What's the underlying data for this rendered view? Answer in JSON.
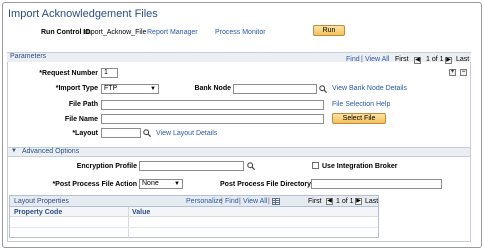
{
  "page": {
    "title": "Import Acknowledgement Files",
    "run_control_label": "Run Control ID",
    "run_control_value": "Import_Acknow_File",
    "report_manager": "Report Manager",
    "process_monitor": "Process Monitor",
    "run_button": "Run"
  },
  "parameters": {
    "header": "Parameters",
    "find": "Find",
    "view_all": "View All",
    "first": "First",
    "pager": "1 of 1",
    "last": "Last",
    "request_number_label": "*Request Number",
    "request_number_value": "1",
    "import_type_label": "*Import Type",
    "import_type_value": "FTP",
    "bank_node_label": "Bank Node",
    "bank_node_value": "",
    "view_bank_node_details": "View Bank Node Details",
    "file_path_label": "File Path",
    "file_path_value": "",
    "file_selection_help": "File Selection Help",
    "file_name_label": "File Name",
    "file_name_value": "",
    "select_file_button": "Select File",
    "layout_label": "*Layout",
    "layout_value": "",
    "view_layout_details": "View Layout Details"
  },
  "advanced": {
    "header": "Advanced Options",
    "encryption_profile_label": "Encryption Profile",
    "encryption_profile_value": "",
    "use_integration_broker_label": "Use Integration Broker",
    "use_integration_broker_checked": false,
    "post_process_action_label": "*Post Process File Action",
    "post_process_action_value": "None",
    "post_process_dir_label": "Post Process File Directory",
    "post_process_dir_value": ""
  },
  "layout_properties": {
    "header": "Layout Properties",
    "personalize": "Personalize",
    "find": "Find",
    "view_all": "View All",
    "first": "First",
    "pager": "1 of 1",
    "last": "Last",
    "columns": [
      "Property Code",
      "Value"
    ]
  },
  "icons": {
    "lookup": "magnifier-icon",
    "add": "plus-icon",
    "delete": "minus-icon",
    "prev": "arrow-left-icon",
    "next": "arrow-right-icon",
    "collapse": "triangle-down-icon",
    "download": "grid-download-icon"
  },
  "colors": {
    "title": "#2b4e83",
    "link": "#2a59a6",
    "button": "#f4c05c",
    "section_bar": "#ebeef3"
  }
}
